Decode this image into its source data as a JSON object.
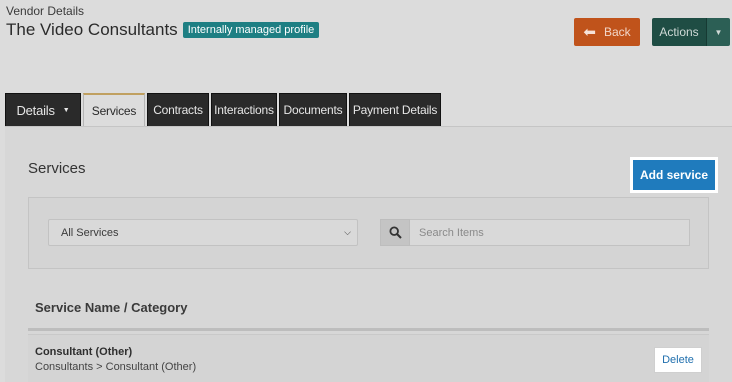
{
  "header": {
    "breadcrumb": "Vendor Details",
    "vendor_name": "The Video Consultants",
    "profile_badge": "Internally managed profile",
    "back_label": "Back",
    "actions_label": "Actions"
  },
  "tabs": [
    {
      "label": "Details",
      "has_dropdown": true,
      "active": false
    },
    {
      "label": "Services",
      "active": true
    },
    {
      "label": "Contracts",
      "active": false
    },
    {
      "label": "Interactions",
      "active": false
    },
    {
      "label": "Documents",
      "active": false
    },
    {
      "label": "Payment Details",
      "active": false
    }
  ],
  "services": {
    "title": "Services",
    "add_button_label": "Add service",
    "filter": {
      "selected": "All Services",
      "search_placeholder": "Search Items"
    },
    "table": {
      "column_header": "Service Name / Category",
      "rows": [
        {
          "name": "Consultant (Other)",
          "category": "Consultants > Consultant (Other)",
          "action": "Delete"
        }
      ]
    }
  },
  "colors": {
    "back_button": "#c0531b",
    "actions_button": "#1f4d44",
    "add_button": "#1f7bbd",
    "badge": "#1e7f83"
  }
}
